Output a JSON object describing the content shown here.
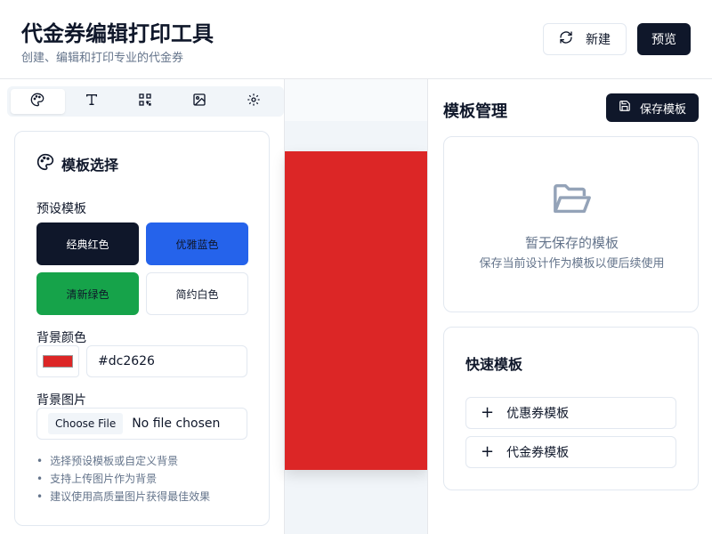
{
  "header": {
    "title": "代金券编辑打印工具",
    "subtitle": "创建、编辑和打印专业的代金券",
    "new_label": "新建",
    "preview_label": "预览"
  },
  "tabs": [
    {
      "icon": "palette-icon"
    },
    {
      "icon": "text-icon"
    },
    {
      "icon": "qr-code-icon"
    },
    {
      "icon": "image-icon"
    },
    {
      "icon": "gear-icon"
    }
  ],
  "template_panel": {
    "title": "模板选择",
    "preset_label": "预设模板",
    "presets": [
      {
        "label": "经典红色",
        "bg": "#0f172a",
        "fg": "#ffffff"
      },
      {
        "label": "优雅蓝色",
        "bg": "#2563eb",
        "fg": "#0f172a"
      },
      {
        "label": "清新绿色",
        "bg": "#16a34a",
        "fg": "#0f172a"
      },
      {
        "label": "简约白色",
        "bg": "#ffffff",
        "fg": "#0f172a"
      }
    ],
    "bg_color_label": "背景颜色",
    "bg_color_value": "#dc2626",
    "bg_image_label": "背景图片",
    "choose_file": "Choose File",
    "no_file": "No file chosen",
    "tips": [
      "选择预设模板或自定义背景",
      "支持上传图片作为背景",
      "建议使用高质量图片获得最佳效果"
    ]
  },
  "canvas": {
    "voucher_color": "#dc2626"
  },
  "template_manager": {
    "title": "模板管理",
    "save_label": "保存模板",
    "empty_title": "暂无保存的模板",
    "empty_subtitle": "保存当前设计作为模板以便后续使用",
    "quick_title": "快速模板",
    "quick_items": [
      "优惠券模板",
      "代金券模板"
    ]
  }
}
